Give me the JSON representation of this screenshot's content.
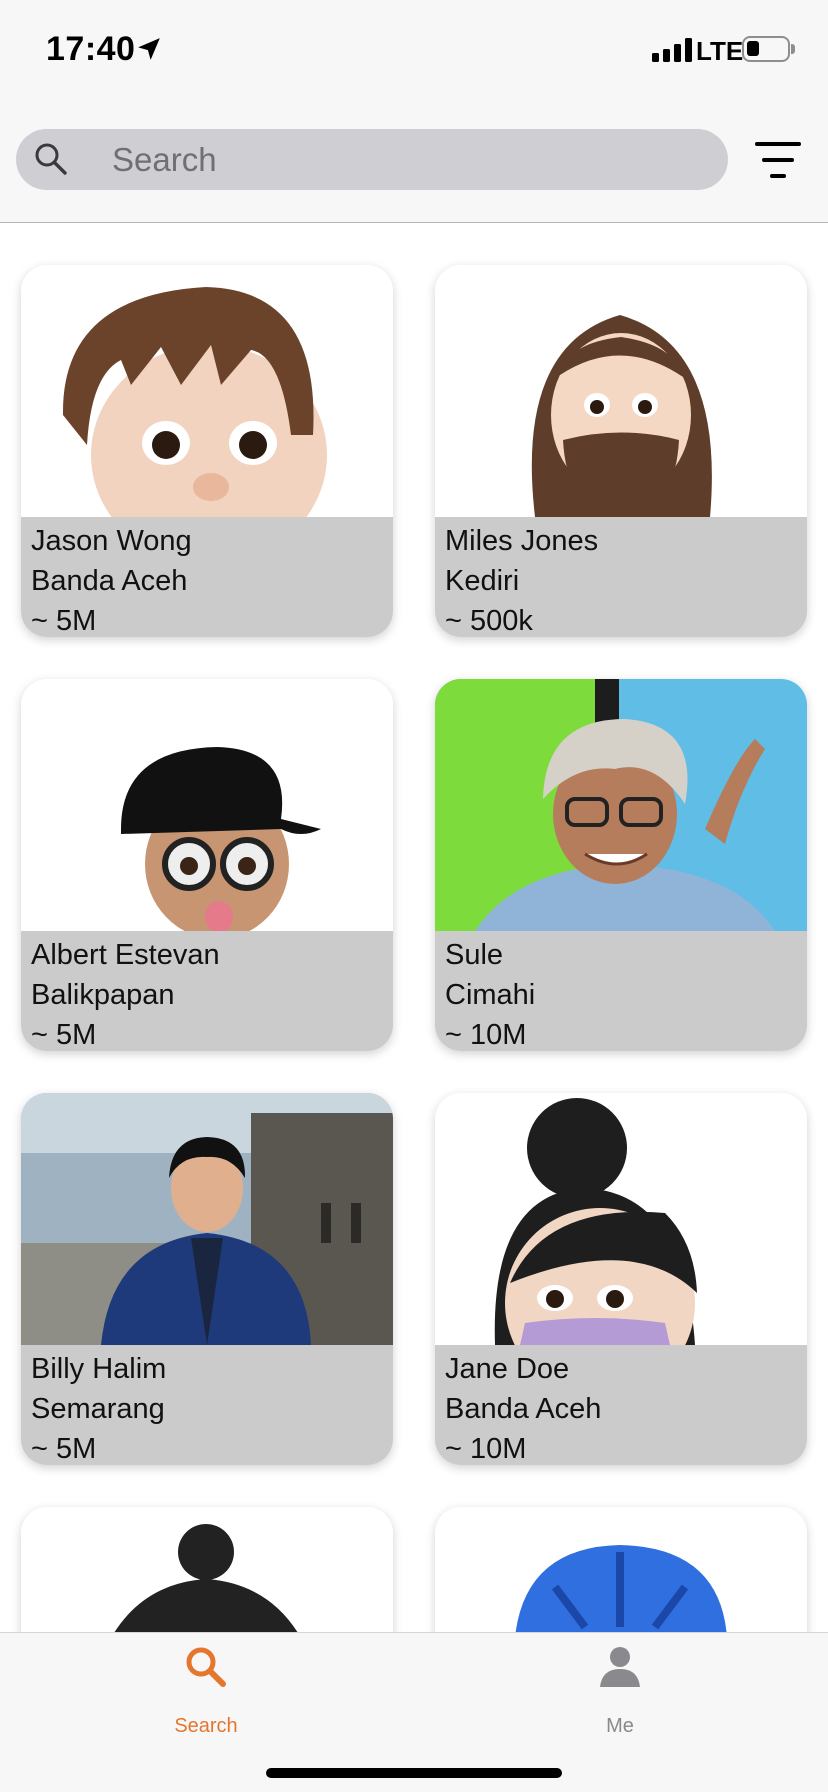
{
  "status_bar": {
    "time": "17:40",
    "network": "LTE",
    "battery_level": 0.2,
    "location_icon": "location-arrow-icon",
    "signal_icon": "cellular-signal-icon",
    "battery_icon": "battery-icon"
  },
  "search": {
    "placeholder": "Search",
    "value": "",
    "icon": "search-icon",
    "filter_icon": "filter-icon"
  },
  "profiles": [
    {
      "name": "Jason Wong",
      "city": "Banda Aceh",
      "followers": "~ 5M"
    },
    {
      "name": "Miles Jones",
      "city": "Kediri",
      "followers": "~ 500k"
    },
    {
      "name": "Albert Estevan",
      "city": "Balikpapan",
      "followers": "~ 5M"
    },
    {
      "name": "Sule",
      "city": "Cimahi",
      "followers": "~ 10M"
    },
    {
      "name": "Billy Halim",
      "city": "Semarang",
      "followers": "~ 5M"
    },
    {
      "name": "Jane Doe",
      "city": "Banda Aceh",
      "followers": "~ 10M"
    }
  ],
  "tab_bar": {
    "tabs": [
      {
        "label": "Search",
        "icon": "search-icon",
        "active": true
      },
      {
        "label": "Me",
        "icon": "person-icon",
        "active": false
      }
    ]
  },
  "colors": {
    "accent": "#e5762e",
    "inactive": "#8a8a8e",
    "card_info_bg": "#cbcbcb",
    "search_bg": "#cfcfd3"
  }
}
